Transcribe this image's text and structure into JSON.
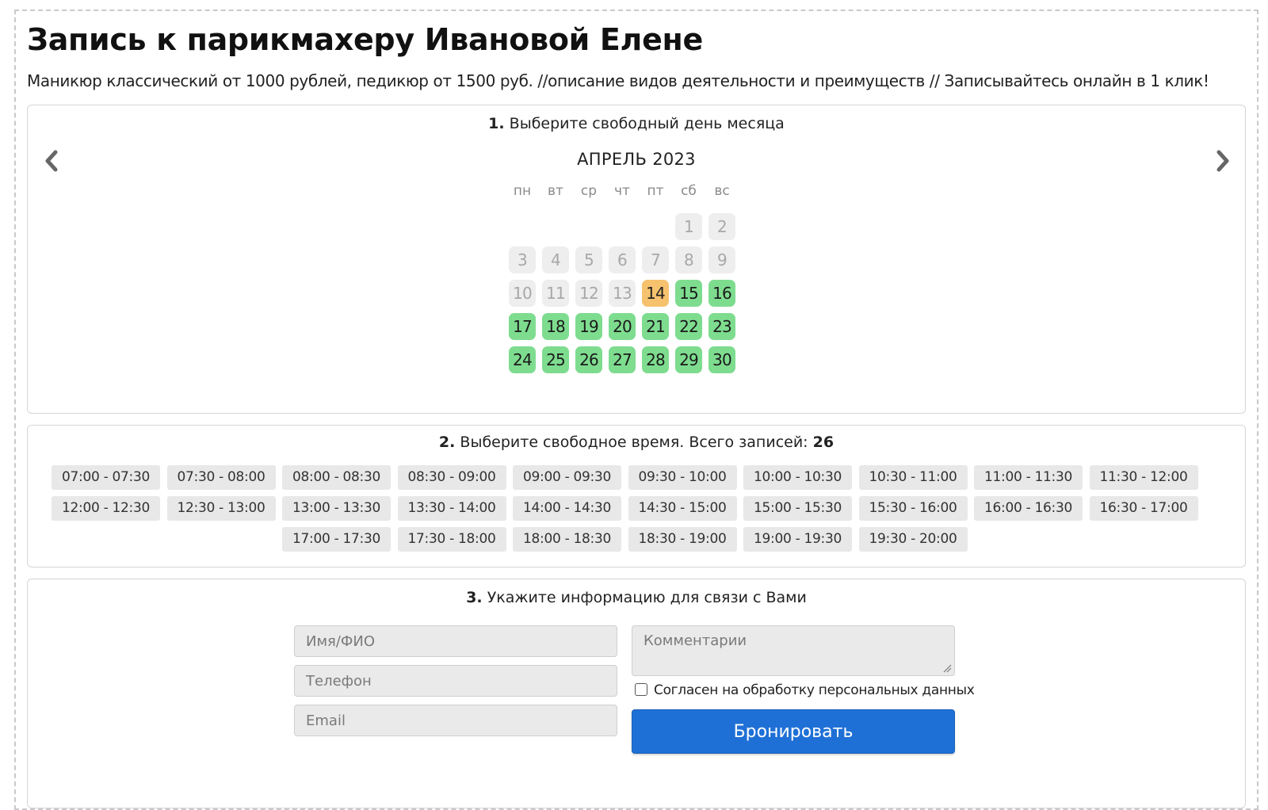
{
  "header": {
    "title": "Запись к парикмахеру Ивановой Елене",
    "description": "Маникюр классический от 1000 рублей, педикюр от 1500 руб. //описание видов деятельности и преимуществ // Записывайтесь онлайн в 1 клик!"
  },
  "calendar": {
    "step_number": "1.",
    "step_label": "Выберите свободный день месяца",
    "month_label": "АПРЕЛЬ 2023",
    "prev_icon": "chevron-left-icon",
    "next_icon": "chevron-right-icon",
    "weekdays": [
      "пн",
      "вт",
      "ср",
      "чт",
      "пт",
      "сб",
      "вс"
    ],
    "first_weekday_index": 5,
    "selected_day": 14,
    "days": [
      {
        "n": "1",
        "state": "past"
      },
      {
        "n": "2",
        "state": "past"
      },
      {
        "n": "3",
        "state": "past"
      },
      {
        "n": "4",
        "state": "past"
      },
      {
        "n": "5",
        "state": "past"
      },
      {
        "n": "6",
        "state": "past"
      },
      {
        "n": "7",
        "state": "past"
      },
      {
        "n": "8",
        "state": "past"
      },
      {
        "n": "9",
        "state": "past"
      },
      {
        "n": "10",
        "state": "past"
      },
      {
        "n": "11",
        "state": "past"
      },
      {
        "n": "12",
        "state": "past"
      },
      {
        "n": "13",
        "state": "past"
      },
      {
        "n": "14",
        "state": "today"
      },
      {
        "n": "15",
        "state": "free"
      },
      {
        "n": "16",
        "state": "free"
      },
      {
        "n": "17",
        "state": "free"
      },
      {
        "n": "18",
        "state": "free"
      },
      {
        "n": "19",
        "state": "free"
      },
      {
        "n": "20",
        "state": "free"
      },
      {
        "n": "21",
        "state": "free"
      },
      {
        "n": "22",
        "state": "free"
      },
      {
        "n": "23",
        "state": "free"
      },
      {
        "n": "24",
        "state": "free"
      },
      {
        "n": "25",
        "state": "free"
      },
      {
        "n": "26",
        "state": "free"
      },
      {
        "n": "27",
        "state": "free"
      },
      {
        "n": "28",
        "state": "free"
      },
      {
        "n": "29",
        "state": "free"
      },
      {
        "n": "30",
        "state": "free"
      }
    ],
    "colors": {
      "past": "#eeeeee",
      "today": "#f6c26e",
      "free": "#7edc8f"
    }
  },
  "time": {
    "step_number": "2.",
    "step_label": "Выберите свободное время. Всего записей:",
    "total_count": "26",
    "slots": [
      "07:00 - 07:30",
      "07:30 - 08:00",
      "08:00 - 08:30",
      "08:30 - 09:00",
      "09:00 - 09:30",
      "09:30 - 10:00",
      "10:00 - 10:30",
      "10:30 - 11:00",
      "11:00 - 11:30",
      "11:30 - 12:00",
      "12:00 - 12:30",
      "12:30 - 13:00",
      "13:00 - 13:30",
      "13:30 - 14:00",
      "14:00 - 14:30",
      "14:30 - 15:00",
      "15:00 - 15:30",
      "15:30 - 16:00",
      "16:00 - 16:30",
      "16:30 - 17:00",
      "17:00 - 17:30",
      "17:30 - 18:00",
      "18:00 - 18:30",
      "18:30 - 19:00",
      "19:00 - 19:30",
      "19:30 - 20:00"
    ]
  },
  "contact": {
    "step_number": "3.",
    "step_label": "Укажите информацию для связи с Вами",
    "name_placeholder": "Имя/ФИО",
    "phone_placeholder": "Телефон",
    "email_placeholder": "Email",
    "comment_placeholder": "Комментарии",
    "consent_label": "Согласен на обработку персональных данных",
    "consent_checked": false,
    "submit_label": "Бронировать",
    "submit_color": "#1f70d6"
  }
}
